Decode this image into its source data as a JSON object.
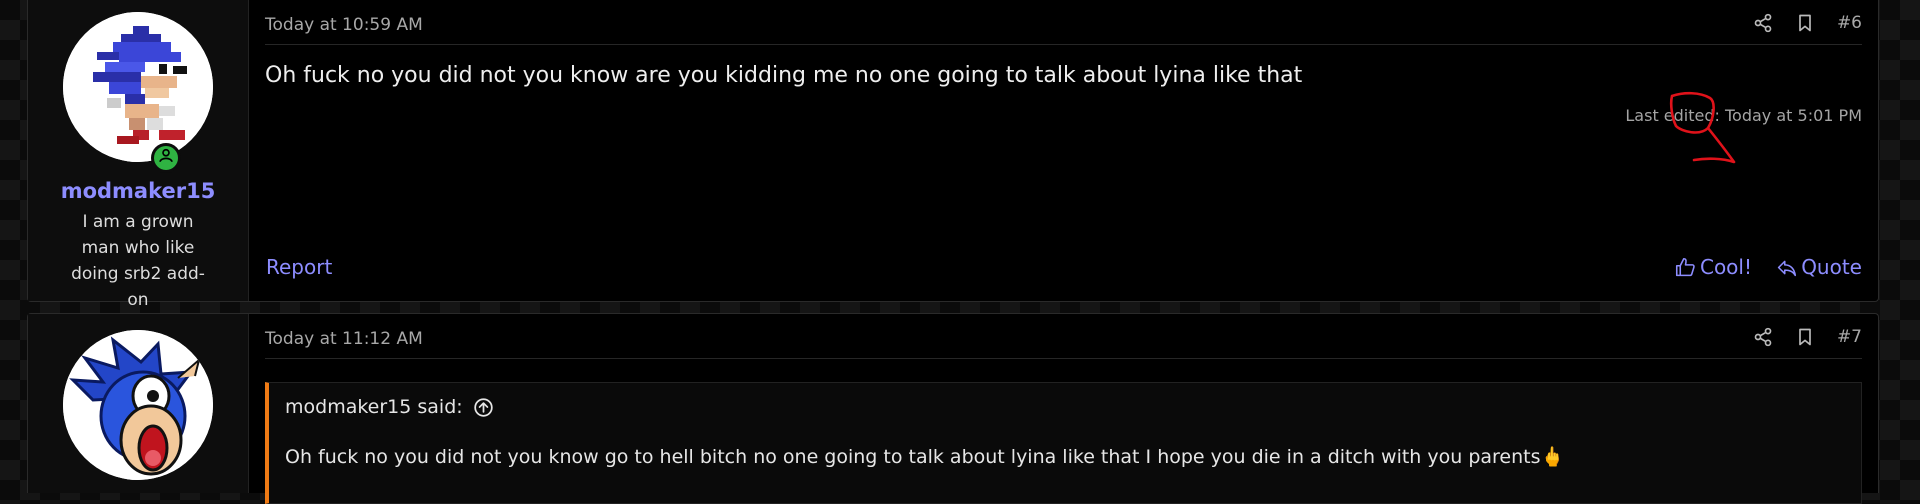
{
  "posts": [
    {
      "username": "modmaker15",
      "user_title": "I am a grown man who like doing srb2 add-on",
      "date": "Today at 10:59 AM",
      "number": "#6",
      "message": "Oh fuck no you did not you know are you kidding me no one going to talk about lyina like that",
      "last_edited": "Last edited: Today at 5:01 PM",
      "report_label": "Report",
      "cool_label": "Cool!",
      "quote_label": "Quote",
      "avatar_icon": "pixel-sonic-avatar-icon"
    },
    {
      "date": "Today at 11:12 AM",
      "number": "#7",
      "quote_author": "modmaker15 said:",
      "quote_text": "Oh fuck no you did not you know go to hell bitch no one going to talk about lyina like that I hope you die in a ditch with you parents",
      "quote_emoji": "🖕",
      "avatar_icon": "cartoon-sonic-avatar-icon"
    }
  ],
  "colors": {
    "username": "#8d8dff",
    "link": "#8d8dff",
    "quote_border": "#f07b15",
    "online": "#2fb342",
    "annotation": "#e0121a"
  }
}
